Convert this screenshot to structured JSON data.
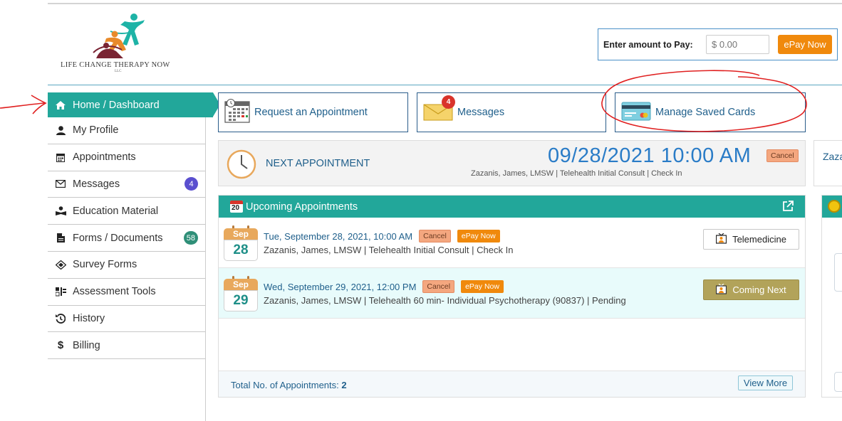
{
  "logo": {
    "name": "LIFE CHANGE THERAPY NOW",
    "suffix": "LLC"
  },
  "pay": {
    "label": "Enter amount to Pay:",
    "placeholder": "$ 0.00",
    "button": "ePay Now"
  },
  "sidebar": {
    "items": [
      {
        "label": "Home / Dashboard",
        "icon": "home-icon",
        "active": true
      },
      {
        "label": "My Profile",
        "icon": "user-icon"
      },
      {
        "label": "Appointments",
        "icon": "calendar-icon"
      },
      {
        "label": "Messages",
        "icon": "envelope-icon",
        "badge": "4"
      },
      {
        "label": "Education Material",
        "icon": "reader-icon"
      },
      {
        "label": "Forms / Documents",
        "icon": "document-icon",
        "badge": "58"
      },
      {
        "label": "Survey Forms",
        "icon": "survey-icon"
      },
      {
        "label": "Assessment Tools",
        "icon": "tools-icon"
      },
      {
        "label": "History",
        "icon": "history-icon"
      },
      {
        "label": "Billing",
        "icon": "dollar-icon"
      }
    ]
  },
  "tiles": {
    "request": "Request an Appointment",
    "messages": "Messages",
    "messages_badge": "4",
    "cards": "Manage Saved Cards"
  },
  "next": {
    "label": "NEXT APPOINTMENT",
    "datetime": "09/28/2021 10:00 AM",
    "cancel": "Cancel",
    "details": "Zazanis, James, LMSW | Telehealth Initial Consult | Check In",
    "peek": "Zaza"
  },
  "upcoming": {
    "title": "Upcoming Appointments",
    "cal_day": "20",
    "appointments": [
      {
        "month": "Sep",
        "day": "28",
        "when": "Tue, September 28, 2021, 10:00 AM",
        "cancel": "Cancel",
        "epay": "ePay Now",
        "details": "Zazanis, James, LMSW | Telehealth Initial Consult | Check In",
        "action": "Telemedicine"
      },
      {
        "month": "Sep",
        "day": "29",
        "when": "Wed, September 29, 2021, 12:00 PM",
        "cancel": "Cancel",
        "epay": "ePay Now",
        "details": "Zazanis, James, LMSW | Telehealth 60 min- Individual Psychotherapy (90837) | Pending",
        "action": "Coming Next"
      }
    ],
    "total_label": "Total No. of Appointments:",
    "total_value": "2",
    "view_more": "View More"
  },
  "colors": {
    "teal": "#22a79a",
    "orange": "#f0890c",
    "link_blue": "#1f5f8b",
    "annotation_red": "#e02020"
  }
}
